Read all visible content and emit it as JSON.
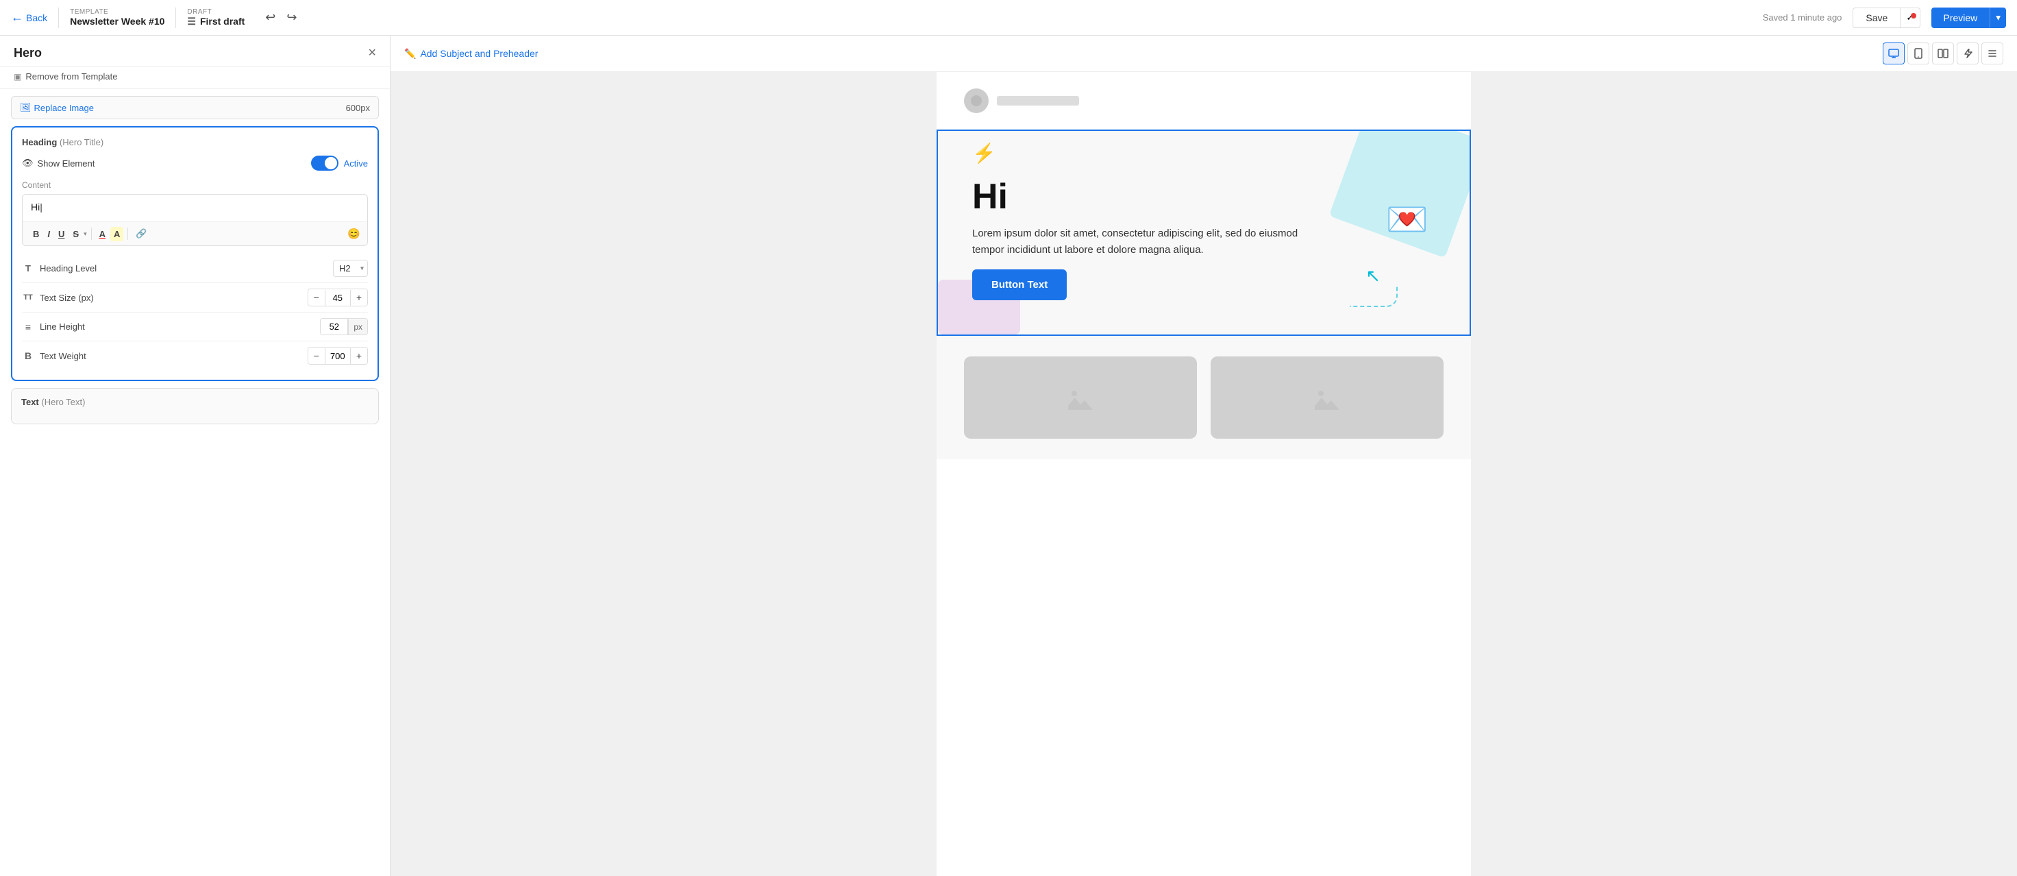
{
  "topbar": {
    "back_label": "Back",
    "template_label": "TEMPLATE",
    "template_title": "Newsletter Week #10",
    "draft_label": "DRAFT",
    "draft_title": "First draft",
    "undo_icon": "↩",
    "redo_icon": "↪",
    "saved_text": "Saved 1 minute ago",
    "save_label": "Save",
    "preview_label": "Preview"
  },
  "panel": {
    "title": "Hero",
    "close_icon": "×",
    "remove_label": "Remove from Template",
    "remove_icon": "▣",
    "replace_image_label": "Replace Image",
    "image_size": "600px",
    "heading_card": {
      "label": "Heading",
      "label_sub": "(Hero Title)",
      "show_element_label": "Show Element",
      "active_label": "Active",
      "content_label": "Content",
      "content_value": "Hi",
      "heading_level_label": "Heading Level",
      "heading_level_value": "H2",
      "text_size_label": "Text Size (px)",
      "text_size_value": "45",
      "line_height_label": "Line Height",
      "line_height_value": "52",
      "text_weight_label": "Text Weight",
      "text_weight_value": "700"
    },
    "text_card_label": "Text",
    "text_card_sub": "(Hero Text)"
  },
  "canvas": {
    "add_subject_label": "Add Subject and Preheader",
    "view_icons": [
      "desktop",
      "tablet",
      "split",
      "lightning",
      "list"
    ],
    "hero": {
      "heading": "Hi",
      "body_text": "Lorem ipsum dolor sit amet, consectetur adipiscing elit, sed do eiusmod tempor incididunt ut labore et dolore magna aliqua.",
      "button_text": "Button Text"
    }
  },
  "editor_toolbar": {
    "bold": "B",
    "italic": "I",
    "underline": "U",
    "strikethrough": "S",
    "font_color": "A",
    "highlight": "A",
    "link": "🔗",
    "emoji": "😊"
  }
}
